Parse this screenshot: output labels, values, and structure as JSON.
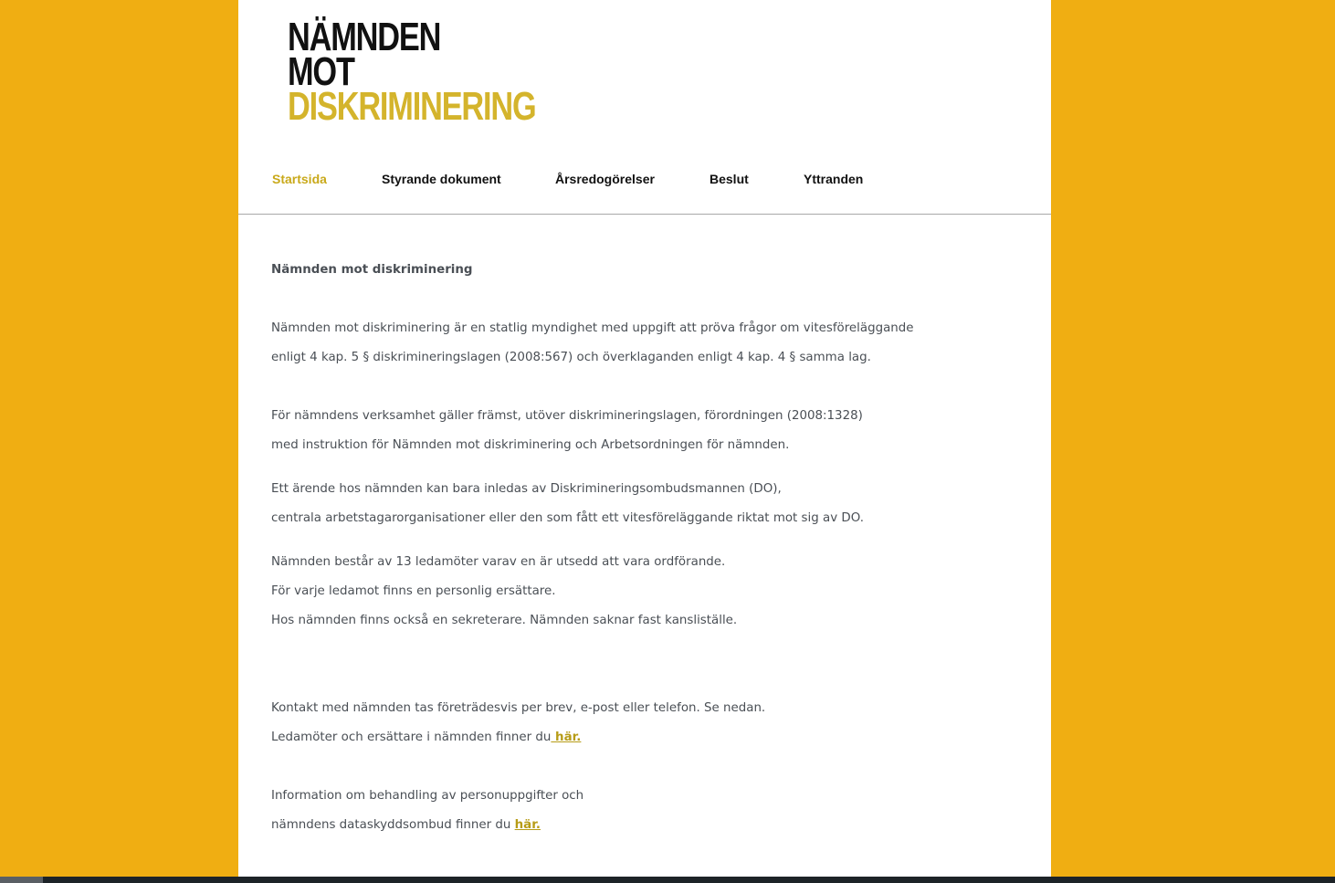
{
  "logo": {
    "line1": "NÄMNDEN",
    "line2": "MOT",
    "line3": "DISKRIMINERING"
  },
  "nav": {
    "items": [
      {
        "label": "Startsida",
        "active": true
      },
      {
        "label": "Styrande dokument",
        "active": false
      },
      {
        "label": "Årsredogörelser",
        "active": false
      },
      {
        "label": "Beslut",
        "active": false
      },
      {
        "label": "Yttranden",
        "active": false
      }
    ]
  },
  "content": {
    "heading": "Nämnden mot diskriminering",
    "p1_l1": "Nämnden mot diskriminering är en statlig myndighet med uppgift att pröva frågor om vitesföreläggande",
    "p1_l2": "enligt 4 kap. 5 § diskrimineringslagen (2008:567) och överklaganden enligt 4 kap. 4 § samma lag.",
    "p2_l1": "För nämndens verksamhet gäller främst, utöver diskrimineringslagen, förordningen (2008:1328)",
    "p2_l2": "med instruktion för Nämnden mot diskriminering och Arbetsordningen för nämnden.",
    "p3_l1": "Ett ärende hos nämnden kan bara inledas av Diskrimineringsombudsmannen (DO),",
    "p3_l2": "centrala arbetstagarorganisationer eller den som fått ett vitesföreläggande riktat mot sig av DO.",
    "p4_l1": "Nämnden består av 13 ledamöter varav en är utsedd att vara ordförande.",
    "p4_l2": "För varje ledamot finns en personlig ersättare.",
    "p4_l3": "Hos nämnden finns också en sekreterare. Nämnden saknar fast kansliställe.",
    "p5_l1": "Kontakt med nämnden tas företrädesvis per brev, e-post eller telefon. Se nedan.",
    "p5_l2_text": "Ledamöter och ersättare i nämnden finner du",
    "p5_l2_link": " här.",
    "p6_l1": "Information om behandling av personuppgifter och",
    "p6_l2_text": "nämndens dataskyddsombud finner du ",
    "p6_l2_link": "här."
  }
}
